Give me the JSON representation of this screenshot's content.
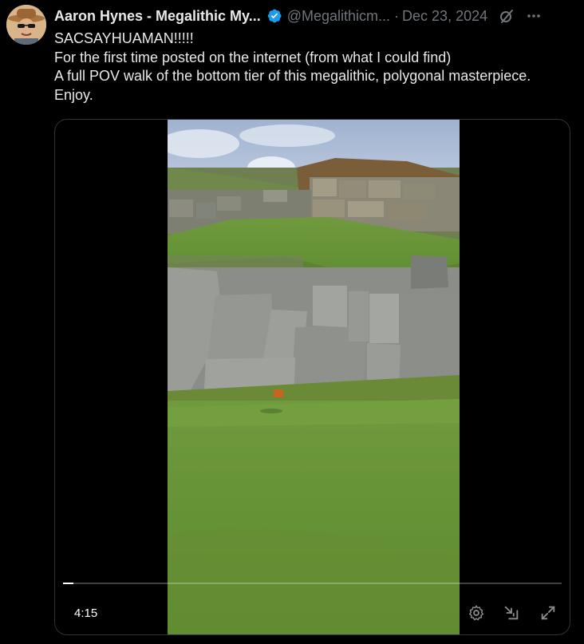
{
  "tweet": {
    "author": {
      "display_name": "Aaron Hynes - Megalithic My...",
      "handle": "@Megalithicm...",
      "verified": true
    },
    "separator": "·",
    "date": "Dec 23, 2024",
    "text_lines": [
      "SACSAYHUAMAN!!!!!",
      "For the first time posted on the internet (from what I could find)",
      "A full POV walk of the bottom tier of this megalithic, polygonal masterpiece.",
      "Enjoy."
    ]
  },
  "video": {
    "duration_label": "4:15",
    "progress_fraction": 0.02,
    "controls": [
      "settings-icon",
      "pop-out-icon",
      "fullscreen-icon"
    ]
  },
  "colors": {
    "background": "#000000",
    "text": "#e7e9ea",
    "muted": "#71767b",
    "verified": "#1d9bf0",
    "border": "#2f3336"
  }
}
